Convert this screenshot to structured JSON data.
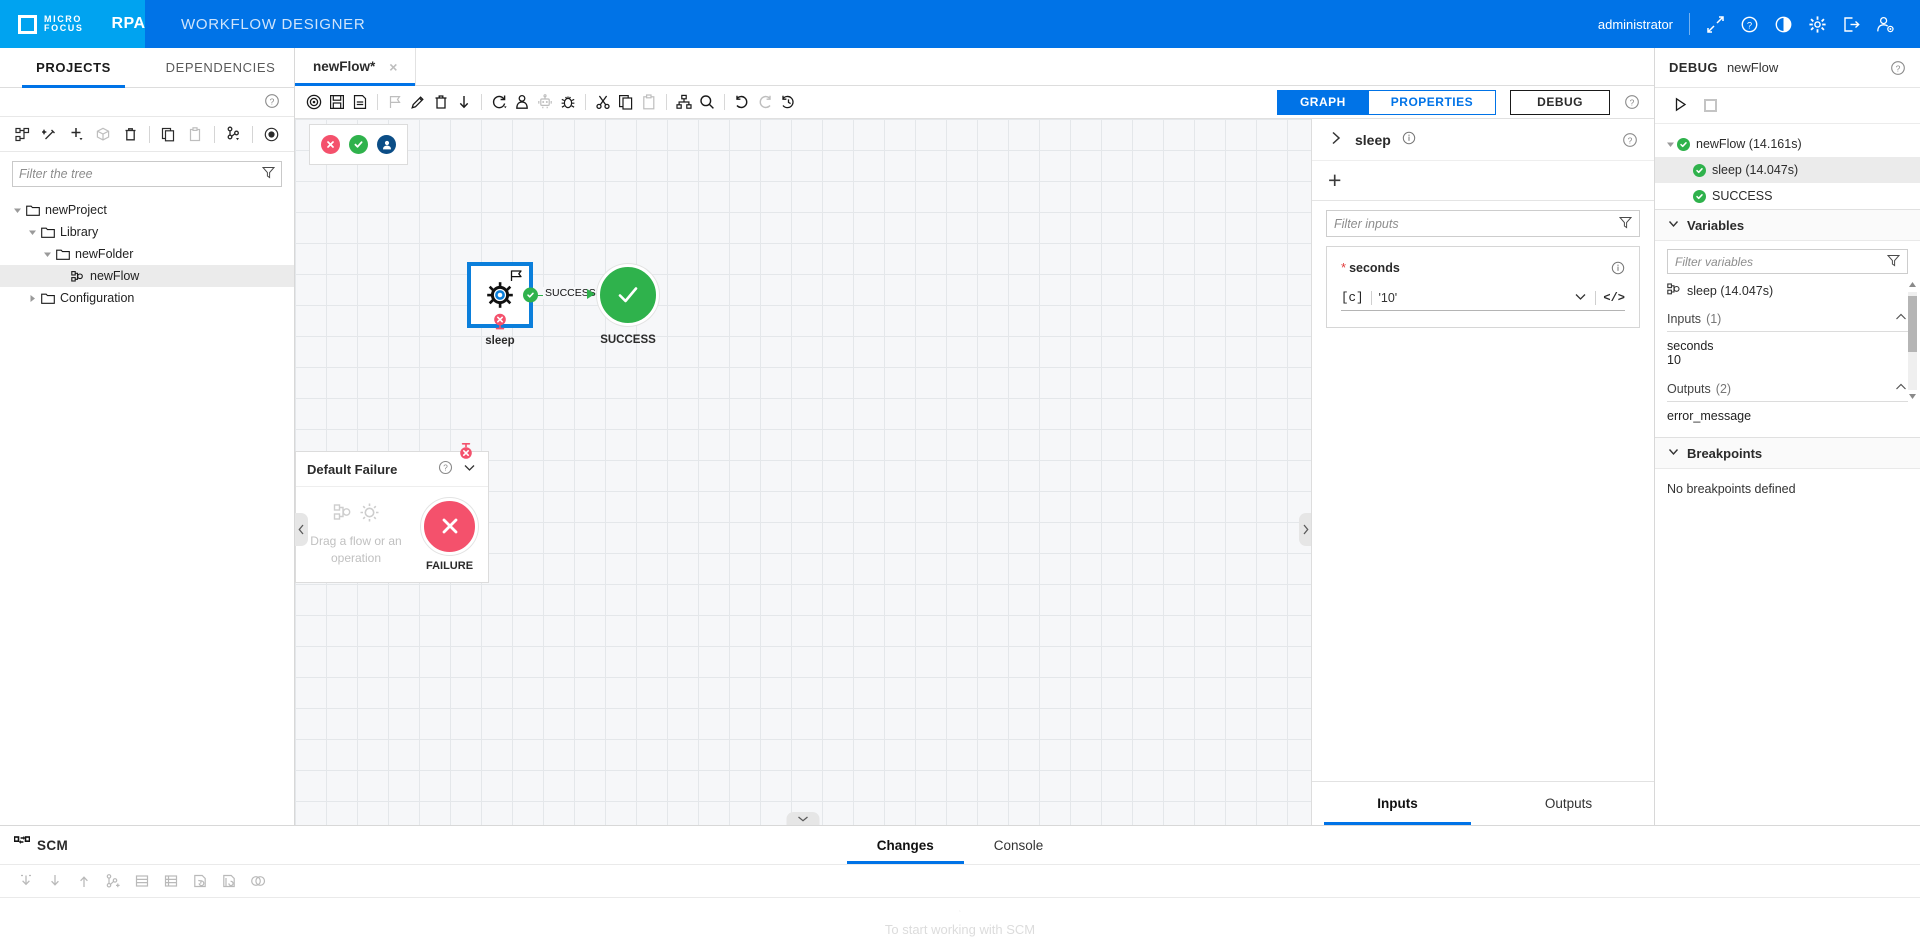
{
  "topbar": {
    "brand_line1": "MICRO",
    "brand_line2": "FOCUS",
    "product": "RPA",
    "app_title": "WORKFLOW DESIGNER",
    "user": "administrator",
    "icons": [
      "expand-icon",
      "help-icon",
      "contrast-icon",
      "gear-icon",
      "logout-icon",
      "user-settings-icon"
    ],
    "accent": "#0073e7",
    "logo_bg": "#00a3f0"
  },
  "left_panel": {
    "tabs": [
      {
        "label": "PROJECTS",
        "active": true
      },
      {
        "label": "DEPENDENCIES",
        "active": false
      }
    ],
    "toolbar": [
      "new-project-icon",
      "magic-wand-icon",
      "add-icon",
      "package-icon",
      "delete-icon",
      "copy-icon",
      "paste-icon",
      "scm-branch-icon",
      "target-icon"
    ],
    "filter_placeholder": "Filter the tree",
    "filter_value": "",
    "tree": [
      {
        "label": "newProject",
        "depth": 0,
        "icon": "folder-icon",
        "arrow": "down",
        "selected": false
      },
      {
        "label": "Library",
        "depth": 1,
        "icon": "folder-icon",
        "arrow": "down",
        "selected": false
      },
      {
        "label": "newFolder",
        "depth": 2,
        "icon": "folder-icon",
        "arrow": "down",
        "selected": false
      },
      {
        "label": "newFlow",
        "depth": 3,
        "icon": "flow-icon",
        "arrow": "none",
        "selected": true
      },
      {
        "label": "Configuration",
        "depth": 1,
        "icon": "folder-icon",
        "arrow": "right",
        "selected": false
      }
    ]
  },
  "editor": {
    "tab_label": "newFlow*",
    "close_glyph": "×",
    "toolbar": [
      "target-icon",
      "save-icon",
      "save-as-icon",
      "flag-icon",
      "edit-icon",
      "delete-icon",
      "download-icon",
      "refresh-icon",
      "robot-user-icon",
      "robot-icon",
      "debug-bug-icon",
      "cut-icon",
      "copy-icon",
      "paste-icon",
      "hierarchy-icon",
      "search-icon",
      "undo-icon",
      "redo-icon",
      "history-icon"
    ],
    "view_buttons": [
      {
        "label": "GRAPH",
        "active": true
      },
      {
        "label": "PROPERTIES",
        "active": false
      }
    ],
    "debug_button": "DEBUG"
  },
  "canvas": {
    "legend": [
      {
        "name": "failure-status-icon",
        "color": "#f4516c"
      },
      {
        "name": "success-status-icon",
        "color": "#2fb24c"
      },
      {
        "name": "user-status-icon",
        "color": "#0b4d86"
      }
    ],
    "nodes": [
      {
        "id": "sleep",
        "label": "sleep",
        "type": "operation",
        "selected": true
      },
      {
        "id": "success",
        "label": "SUCCESS",
        "type": "end-success"
      }
    ],
    "edge_label": "SUCCESS",
    "failure_panel": {
      "title": "Default Failure",
      "drop_hint_line1": "Drag a flow or an",
      "drop_hint_line2": "operation",
      "failure_label": "FAILURE"
    }
  },
  "properties": {
    "node_name": "sleep",
    "filter_placeholder": "Filter inputs",
    "filter_value": "",
    "inputs": [
      {
        "name": "seconds",
        "required": true,
        "type_tag": "[c]",
        "value": "'10'"
      }
    ],
    "tabs": [
      {
        "label": "Inputs",
        "active": true
      },
      {
        "label": "Outputs",
        "active": false
      }
    ]
  },
  "debug_panel": {
    "title": "DEBUG",
    "flow_name": "newFlow",
    "controls": [
      "resume-icon",
      "stop-icon"
    ],
    "run_tree": [
      {
        "label": "newFlow (14.161s)",
        "depth": 0,
        "status": "success",
        "arrow": "down",
        "selected": false
      },
      {
        "label": "sleep (14.047s)",
        "depth": 1,
        "status": "success",
        "arrow": "none",
        "selected": true
      },
      {
        "label": "SUCCESS",
        "depth": 1,
        "status": "success",
        "arrow": "none",
        "selected": false
      }
    ],
    "variables": {
      "section_title": "Variables",
      "filter_placeholder": "Filter variables",
      "filter_value": "",
      "context_label": "sleep (14.047s)",
      "groups": [
        {
          "title": "Inputs",
          "count": "(1)",
          "items": [
            {
              "name": "seconds",
              "value": "10"
            }
          ]
        },
        {
          "title": "Outputs",
          "count": "(2)",
          "items": [
            {
              "name": "error_message",
              "value": ""
            }
          ]
        }
      ]
    },
    "breakpoints": {
      "section_title": "Breakpoints",
      "empty_text": "No breakpoints defined"
    }
  },
  "scm": {
    "title": "SCM",
    "tabs": [
      {
        "label": "Changes",
        "active": true
      },
      {
        "label": "Console",
        "active": false
      }
    ],
    "toolbar": [
      "pull-icon",
      "fetch-icon",
      "push-icon",
      "branch-icon",
      "commit-icon",
      "commit-all-icon",
      "revert-icon",
      "revert-all-icon",
      "link-icon"
    ],
    "empty_text": "To start working with SCM"
  }
}
